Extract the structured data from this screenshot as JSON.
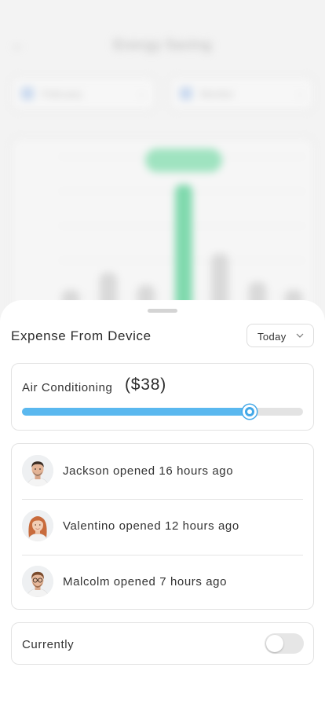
{
  "background": {
    "title": "Energy Saving",
    "filter_left": "February",
    "filter_right": "Monitor",
    "bar_levels": [
      0.33,
      0.44,
      0.36,
      1.0,
      0.56,
      0.38,
      0.33
    ],
    "highlight_index": 3
  },
  "sheet": {
    "title": "Expense From Device",
    "period": {
      "label": "Today",
      "options": [
        "Today"
      ]
    },
    "expense": {
      "device": "Air Conditioning",
      "amount": "($38)",
      "slider_fraction": 0.81,
      "accent_color": "#5ab8ef"
    },
    "activity": [
      {
        "text": "Jackson opened 16 hours ago",
        "avatar": "man-avatar"
      },
      {
        "text": "Valentino opened 12 hours ago",
        "avatar": "woman-avatar"
      },
      {
        "text": "Malcolm opened 7 hours ago",
        "avatar": "man-glasses-avatar"
      }
    ],
    "currently": {
      "label": "Currently",
      "on": false
    }
  }
}
